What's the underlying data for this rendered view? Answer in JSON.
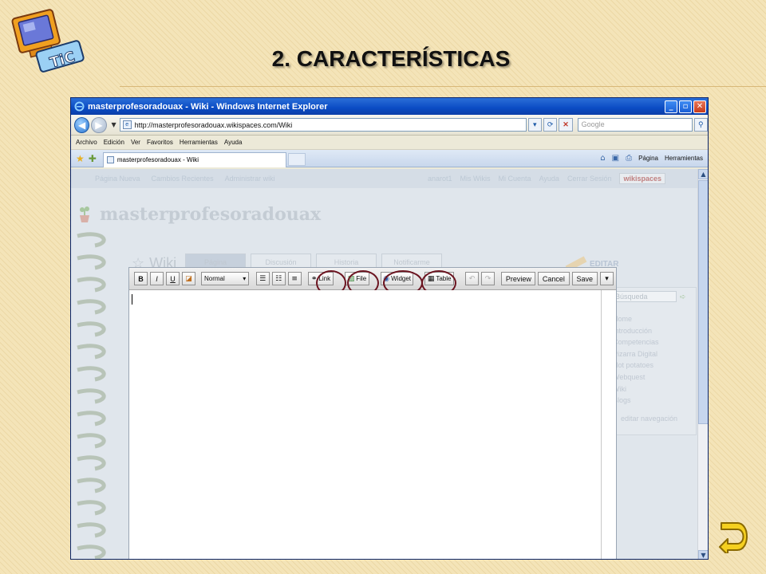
{
  "slide": {
    "title": "2. CARACTERÍSTICAS",
    "logo_text": "TiC",
    "back_arrow_icon": "u-turn-arrow-icon"
  },
  "browser": {
    "window_title": "masterprofesoradouax - Wiki - Windows Internet Explorer",
    "controls": {
      "minimize": "_",
      "maximize": "▫",
      "close": "✕"
    },
    "address": "http://masterprofesoradouax.wikispaces.com/Wiki",
    "search_placeholder": "Google",
    "menu": [
      "Archivo",
      "Edición",
      "Ver",
      "Favoritos",
      "Herramientas",
      "Ayuda"
    ],
    "tab_label": "masterprofesoradouax - Wiki",
    "commands": {
      "page": "Página",
      "tools": "Herramientas"
    }
  },
  "page": {
    "topnav": [
      "Página Nueva",
      "Cambios Recientes",
      "Administrar wiki"
    ],
    "user_links": [
      "anarot1",
      "Mis Wikis",
      "Mi Cuenta",
      "Ayuda",
      "Cerrar Sesión"
    ],
    "wikispaces_badge": "wikispaces",
    "site_name": "masterprofesoradouax",
    "wiki_heading": "Wiki",
    "tabs": [
      "Página",
      "Discusión",
      "Historia",
      "Notificarme"
    ],
    "edit_label": "EDITAR"
  },
  "editor": {
    "toolbar": {
      "bold": "B",
      "italic": "I",
      "underline": "U",
      "format_value": "Normal",
      "link": "Link",
      "file": "File",
      "widget": "Widget",
      "table": "Table",
      "preview": "Preview",
      "cancel": "Cancel",
      "save": "Save"
    },
    "highlight_color": "#6b1420"
  },
  "sidebar": {
    "search_placeholder": "Búsqueda",
    "items": [
      "Home",
      "Introducción",
      "Competencias",
      "Pizarra Digital",
      "Hot potatoes",
      "Webquest",
      "Wiki",
      "Blogs"
    ],
    "edit_nav": "editar navegación"
  }
}
